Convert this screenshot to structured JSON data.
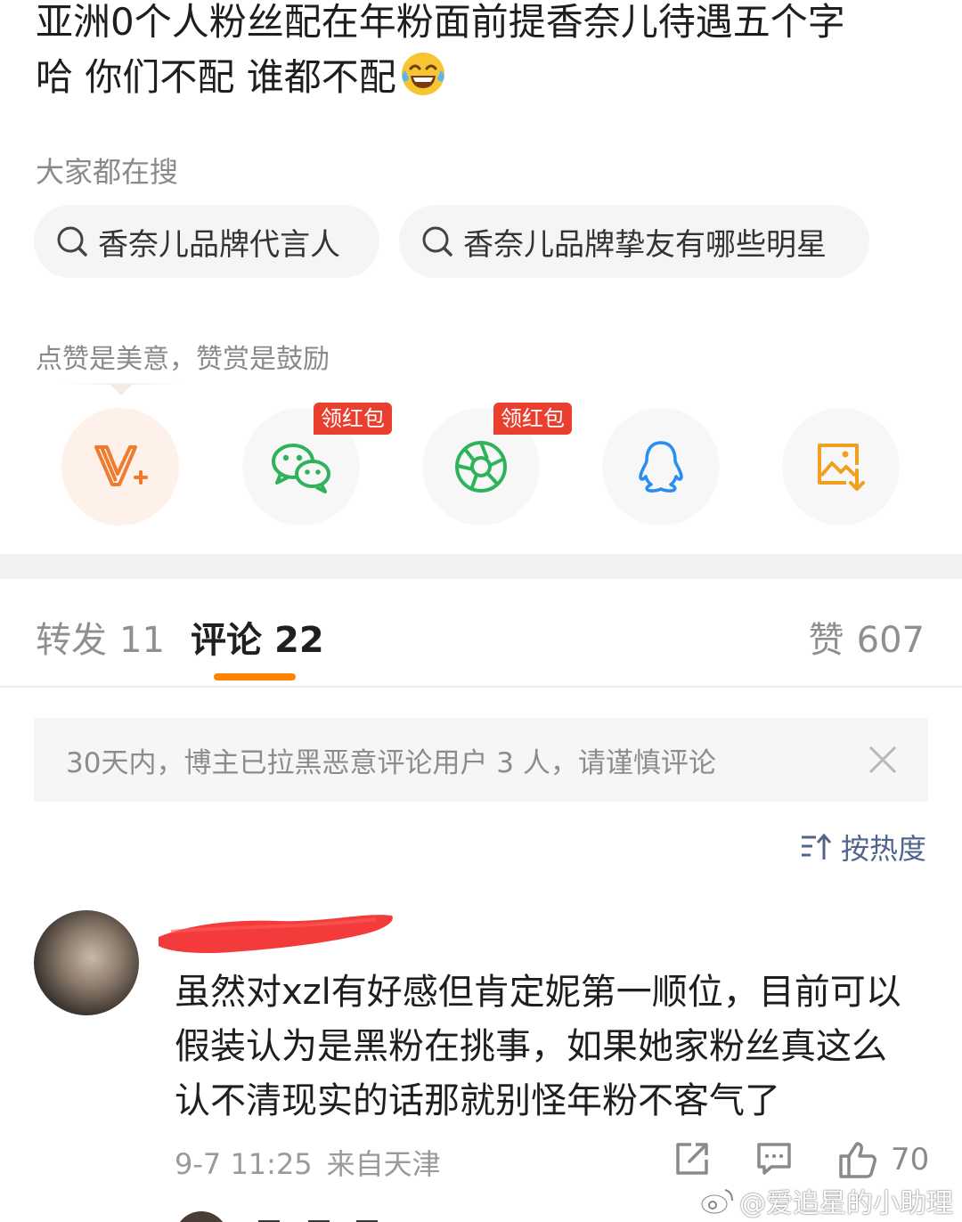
{
  "post": {
    "line1": "亚洲0个人粉丝配在年粉面前提香奈儿待遇五个字",
    "line2": "哈 你们不配 谁都不配",
    "emoji_icon": "laughing-tears-emoji"
  },
  "search": {
    "heading": "大家都在搜",
    "suggestions": [
      "香奈儿品牌代言人",
      "香奈儿品牌挚友有哪些明星"
    ]
  },
  "reward": {
    "heading": "点赞是美意，赞赏是鼓励",
    "buttons": [
      {
        "icon": "v-plus-icon",
        "color": "#f07a2e"
      },
      {
        "icon": "wechat-icon",
        "badge": "领红包",
        "color": "#2fb35a"
      },
      {
        "icon": "moments-icon",
        "badge": "领红包",
        "color": "#2fb35a"
      },
      {
        "icon": "qq-icon",
        "color": "#2a8ef0"
      },
      {
        "icon": "save-image-icon",
        "color": "#f0a020"
      }
    ]
  },
  "tabs": {
    "repost_label": "转发",
    "repost_count": "11",
    "comment_label": "评论",
    "comment_count": "22",
    "like_label": "赞",
    "like_count": "607",
    "accent": "#ff8200"
  },
  "notice": {
    "text": "30天内，博主已拉黑恶意评论用户 3 人，请谨慎评论"
  },
  "sort": {
    "label": "按热度"
  },
  "comment": {
    "lines": [
      "虽然对xzl有好感但肯定妮第一顺位，目前可以",
      "假装认为是黑粉在挑事，如果她家粉丝真这么",
      "认不清现实的话那就别怪年粉不客气了"
    ],
    "time": "9-7 11:25",
    "location": "来自天津",
    "likes": "70"
  },
  "watermark": {
    "text": "@爱追星的小助理"
  }
}
